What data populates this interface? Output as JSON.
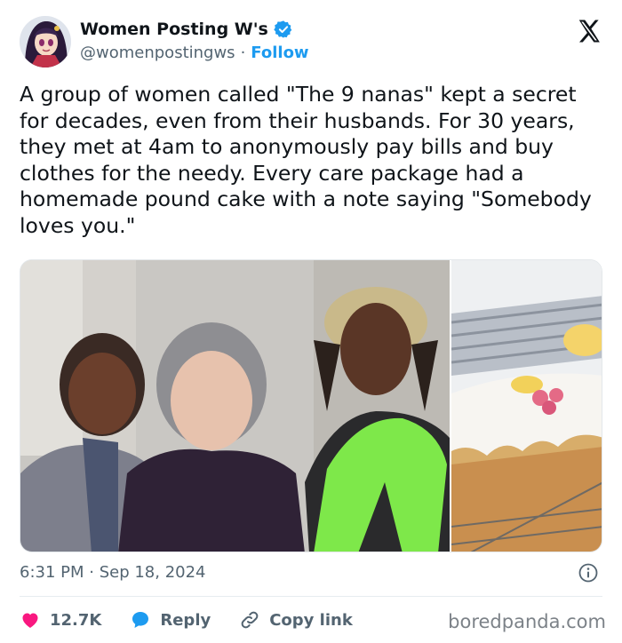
{
  "tweet": {
    "display_name": "Women Posting W's",
    "handle": "@womenpostingws",
    "separator": "·",
    "follow_label": "Follow",
    "text": "A group of women called \"The 9 nanas\" kept a secret for decades, even from their husbands. For 30 years, they met at 4am to anonymously pay bills and buy clothes for the needy. Every care package had a homemade pound cake with a note saying \"Somebody loves you.\"",
    "timestamp": "6:31 PM · Sep 18, 2024"
  },
  "actions": {
    "likes": "12.7K",
    "reply_label": "Reply",
    "copy_link_label": "Copy link"
  },
  "icons": {
    "verified": "verified-badge-icon",
    "platform": "x-logo-icon",
    "info": "info-icon",
    "like": "heart-icon",
    "reply": "speech-bubble-icon",
    "copy": "link-icon"
  },
  "colors": {
    "accent": "#1d9bf0",
    "like": "#f91880",
    "text": "#0f1419",
    "muted": "#536471"
  },
  "watermark": "boredpanda.com"
}
